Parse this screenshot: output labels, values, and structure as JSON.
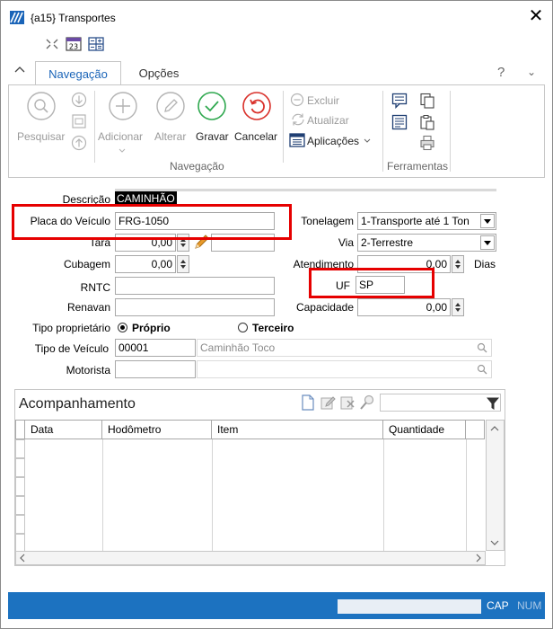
{
  "window": {
    "title": "{a15}  Transportes",
    "close_glyph": "✕"
  },
  "colors": {
    "accent": "#1a64b8",
    "statusbar": "#1c72c0",
    "highlight_box": "#e60000",
    "ok_green": "#2fa84f",
    "cancel_red": "#d9312b"
  },
  "quick_access": {
    "icons": [
      "expand-icon",
      "calendar-icon",
      "calculator-icon"
    ],
    "calendar_day": "23"
  },
  "ribbon": {
    "tabs": [
      {
        "label": "Navegação",
        "active": true
      },
      {
        "label": "Opções",
        "active": false
      }
    ],
    "help": "?",
    "collapse": "⌄",
    "buttons": {
      "pesquisar": "Pesquisar",
      "adicionar": "Adicionar",
      "alterar": "Alterar",
      "gravar": "Gravar",
      "cancelar": "Cancelar",
      "excluir": "Excluir",
      "atualizar": "Atualizar",
      "aplicacoes": "Aplicações"
    },
    "groups": {
      "navegacao": "Navegação",
      "ferramentas": "Ferramentas"
    }
  },
  "form": {
    "descricao": {
      "label": "Descrição",
      "value": "CAMINHÃO"
    },
    "placa": {
      "label": "Placa do Veículo",
      "value": "FRG-1050"
    },
    "tara": {
      "label": "Tara",
      "value": "0,00"
    },
    "cubagem": {
      "label": "Cubagem",
      "value": "0,00"
    },
    "rntc": {
      "label": "RNTC",
      "value": ""
    },
    "renavan": {
      "label": "Renavan",
      "value": ""
    },
    "tonelagem": {
      "label": "Tonelagem",
      "value": "1-Transporte até 1 Ton"
    },
    "via": {
      "label": "Via",
      "value": "2-Terrestre"
    },
    "atendimento": {
      "label": "Atendimento",
      "value": "0,00",
      "unit": "Dias"
    },
    "uf": {
      "label": "UF",
      "value": "SP"
    },
    "capacidade": {
      "label": "Capacidade",
      "value": "0,00"
    },
    "tipo_proprietario": {
      "label": "Tipo proprietário",
      "options": [
        {
          "label": "Próprio",
          "checked": true
        },
        {
          "label": "Terceiro",
          "checked": false
        }
      ]
    },
    "tipo_veiculo": {
      "label": "Tipo de Veículo",
      "code": "00001",
      "description": "Caminhão Toco"
    },
    "motorista": {
      "label": "Motorista",
      "code": "",
      "description": ""
    }
  },
  "grid": {
    "title": "Acompanhamento",
    "columns": [
      "Data",
      "Hodômetro",
      "Item",
      "Quantidade"
    ],
    "rows": []
  },
  "statusbar": {
    "cap": "CAP",
    "num": "NUM"
  }
}
